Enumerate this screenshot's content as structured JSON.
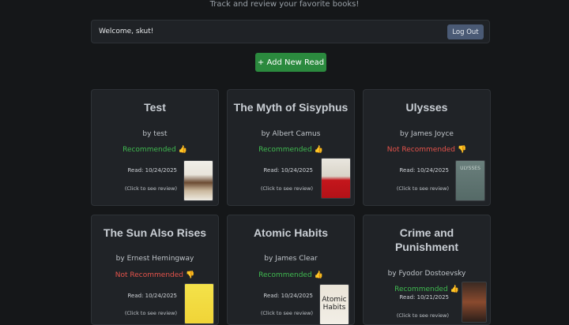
{
  "header": {
    "subtitle": "Track and review your favorite books!"
  },
  "topbar": {
    "welcome": "Welcome, skut!",
    "logout_label": "Log Out"
  },
  "actions": {
    "add_label": "+ Add New Read"
  },
  "books": [
    {
      "title": "Test",
      "author": "by test",
      "recommendation": "Recommended",
      "thumb": "👍",
      "date": "Read: 10/24/2025",
      "hint": "(Click to see review)",
      "cover_text": ""
    },
    {
      "title": "The Myth of Sisyphus",
      "author": "by Albert Camus",
      "recommendation": "Recommended",
      "thumb": "👍",
      "date": "Read: 10/24/2025",
      "hint": "(Click to see review)",
      "cover_text": ""
    },
    {
      "title": "Ulysses",
      "author": "by James Joyce",
      "recommendation": "Not Recommended",
      "thumb": "👎",
      "date": "Read: 10/24/2025",
      "hint": "(Click to see review)",
      "cover_text": "ULYSSES"
    },
    {
      "title": "The Sun Also Rises",
      "author": "by Ernest Hemingway",
      "recommendation": "Not Recommended",
      "thumb": "👎",
      "date": "Read: 10/24/2025",
      "hint": "(Click to see review)",
      "cover_text": ""
    },
    {
      "title": "Atomic Habits",
      "author": "by James Clear",
      "recommendation": "Recommended",
      "thumb": "👍",
      "date": "Read: 10/24/2025",
      "hint": "(Click to see review)",
      "cover_text": "Atomic Habits"
    },
    {
      "title": "Crime and Punishment",
      "author": "by Fyodor Dostoevsky",
      "recommendation": "Recommended",
      "thumb": "👍",
      "date": "Read: 10/21/2025",
      "hint": "(Click to see review)",
      "cover_text": ""
    }
  ],
  "colors": {
    "recommended": "#3fb950",
    "not_recommended": "#e5534b",
    "add_button": "#2b8a3e",
    "logout_button": "#4a5a75"
  }
}
